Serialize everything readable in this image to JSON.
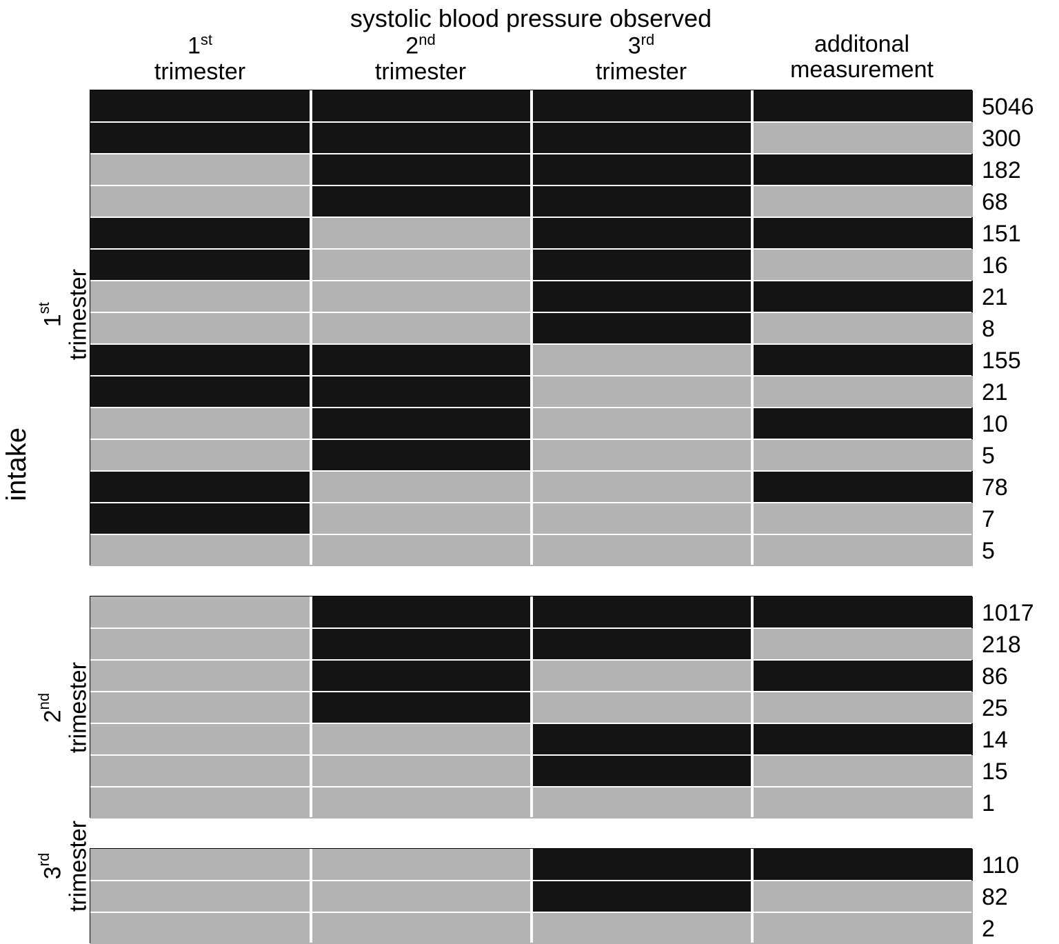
{
  "chart_data": {
    "type": "table",
    "title": "systolic blood pressure observed",
    "axis_label": "intake",
    "columns": [
      {
        "label": "1st trimester",
        "sup": "st",
        "base": "1"
      },
      {
        "label": "2nd trimester",
        "sup": "nd",
        "base": "2"
      },
      {
        "label": "3rd trimester",
        "sup": "rd",
        "base": "3"
      },
      {
        "label": "additonal measurement"
      }
    ],
    "colors": {
      "observed": "#141414",
      "missing": "#b3b3b3"
    },
    "groups": [
      {
        "name": "1st trimester",
        "sup": "st",
        "base": "1",
        "rows": [
          {
            "cells": [
              1,
              1,
              1,
              1
            ],
            "count": 5046
          },
          {
            "cells": [
              1,
              1,
              1,
              0
            ],
            "count": 300
          },
          {
            "cells": [
              0,
              1,
              1,
              1
            ],
            "count": 182
          },
          {
            "cells": [
              0,
              1,
              1,
              0
            ],
            "count": 68
          },
          {
            "cells": [
              1,
              0,
              1,
              1
            ],
            "count": 151
          },
          {
            "cells": [
              1,
              0,
              1,
              0
            ],
            "count": 16
          },
          {
            "cells": [
              0,
              0,
              1,
              1
            ],
            "count": 21
          },
          {
            "cells": [
              0,
              0,
              1,
              0
            ],
            "count": 8
          },
          {
            "cells": [
              1,
              1,
              0,
              1
            ],
            "count": 155
          },
          {
            "cells": [
              1,
              1,
              0,
              0
            ],
            "count": 21
          },
          {
            "cells": [
              0,
              1,
              0,
              1
            ],
            "count": 10
          },
          {
            "cells": [
              0,
              1,
              0,
              0
            ],
            "count": 5
          },
          {
            "cells": [
              1,
              0,
              0,
              1
            ],
            "count": 78
          },
          {
            "cells": [
              1,
              0,
              0,
              0
            ],
            "count": 7
          },
          {
            "cells": [
              0,
              0,
              0,
              0
            ],
            "count": 5
          }
        ]
      },
      {
        "name": "2nd trimester",
        "sup": "nd",
        "base": "2",
        "rows": [
          {
            "cells": [
              0,
              1,
              1,
              1
            ],
            "count": 1017
          },
          {
            "cells": [
              0,
              1,
              1,
              0
            ],
            "count": 218
          },
          {
            "cells": [
              0,
              1,
              0,
              1
            ],
            "count": 86
          },
          {
            "cells": [
              0,
              1,
              0,
              0
            ],
            "count": 25
          },
          {
            "cells": [
              0,
              0,
              1,
              1
            ],
            "count": 14
          },
          {
            "cells": [
              0,
              0,
              1,
              0
            ],
            "count": 15
          },
          {
            "cells": [
              0,
              0,
              0,
              0
            ],
            "count": 1
          }
        ]
      },
      {
        "name": "3rd trimester",
        "sup": "rd",
        "base": "3",
        "rows": [
          {
            "cells": [
              0,
              0,
              1,
              1
            ],
            "count": 110
          },
          {
            "cells": [
              0,
              0,
              1,
              0
            ],
            "count": 82
          },
          {
            "cells": [
              0,
              0,
              0,
              0
            ],
            "count": 2
          }
        ]
      }
    ]
  }
}
